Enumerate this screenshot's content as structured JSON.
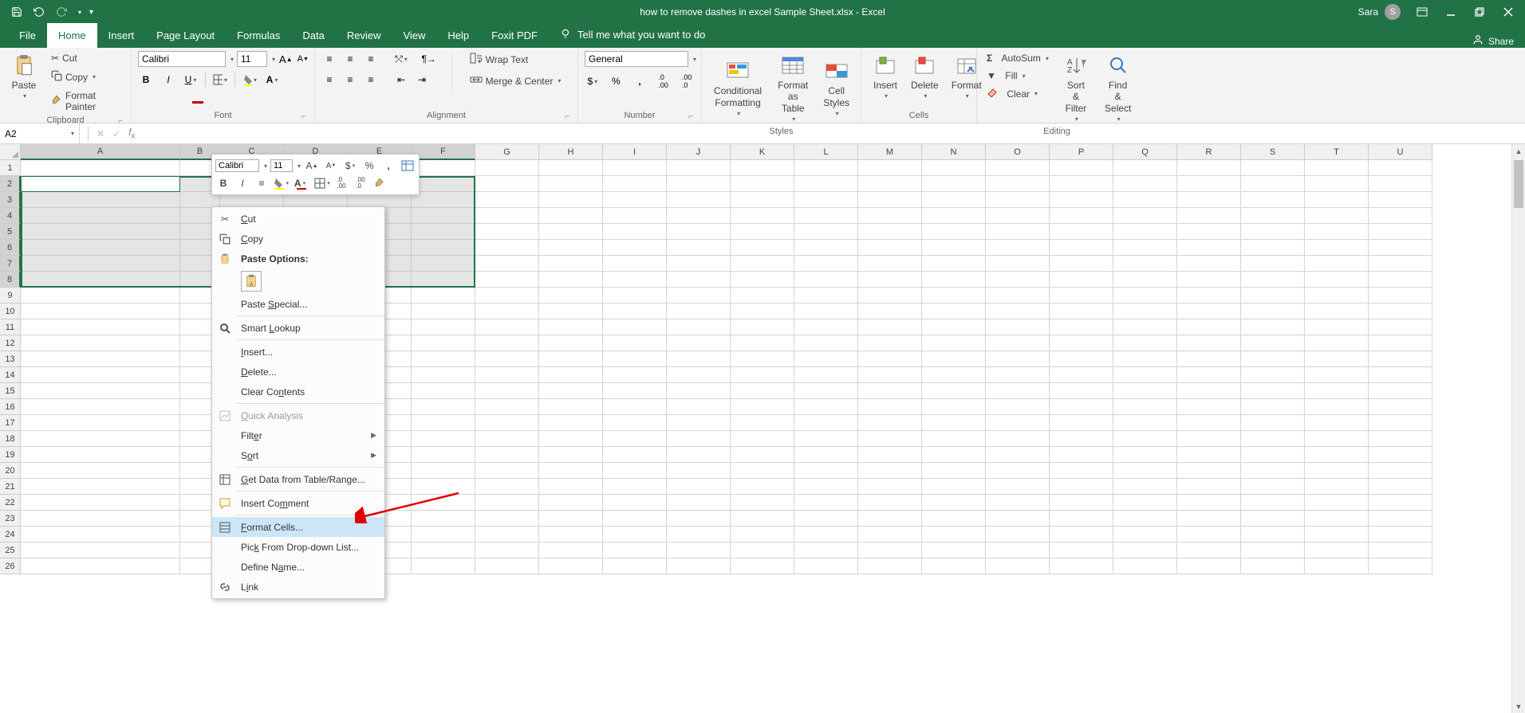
{
  "title": "how to remove dashes in excel Sample Sheet.xlsx  -  Excel",
  "user": {
    "name": "Sara",
    "initial": "S"
  },
  "share": "Share",
  "tabs": [
    "File",
    "Home",
    "Insert",
    "Page Layout",
    "Formulas",
    "Data",
    "Review",
    "View",
    "Help",
    "Foxit PDF"
  ],
  "active_tab": "Home",
  "tell_me": "Tell me what you want to do",
  "ribbon": {
    "clipboard": {
      "label": "Clipboard",
      "paste": "Paste",
      "cut": "Cut",
      "copy": "Copy",
      "fp": "Format Painter"
    },
    "font": {
      "label": "Font",
      "name": "Calibri",
      "size": "11"
    },
    "alignment": {
      "label": "Alignment",
      "wrap": "Wrap Text",
      "merge": "Merge & Center"
    },
    "number": {
      "label": "Number",
      "format": "General"
    },
    "styles": {
      "label": "Styles",
      "cond": "Conditional Formatting",
      "fas": "Format as Table",
      "cell": "Cell Styles"
    },
    "cells": {
      "label": "Cells",
      "insert": "Insert",
      "delete": "Delete",
      "format": "Format"
    },
    "editing": {
      "label": "Editing",
      "autosum": "AutoSum",
      "fill": "Fill",
      "clear": "Clear",
      "sort": "Sort & Filter",
      "find": "Find & Select"
    }
  },
  "namebox": "A2",
  "columns": [
    "A",
    "B",
    "C",
    "D",
    "E",
    "F",
    "G",
    "H",
    "I",
    "J",
    "K",
    "L",
    "M",
    "N",
    "O",
    "P",
    "Q",
    "R",
    "S",
    "T",
    "U"
  ],
  "col_widths": {
    "default": 80,
    "A": 200,
    "B": 50
  },
  "rows": 26,
  "selected_rows": [
    2,
    3,
    4,
    5,
    6,
    7,
    8
  ],
  "active_cell": "A2",
  "mini": {
    "font": "Calibri",
    "size": "11"
  },
  "context_menu": {
    "cut": "Cut",
    "copy": "Copy",
    "paste_options": "Paste Options:",
    "paste_special": "Paste Special...",
    "smart": "Smart Lookup",
    "insert": "Insert...",
    "delete": "Delete...",
    "clear": "Clear Contents",
    "quick": "Quick Analysis",
    "filter": "Filter",
    "sort": "Sort",
    "getdata": "Get Data from Table/Range...",
    "comment": "Insert Comment",
    "format": "Format Cells...",
    "pick": "Pick From Drop-down List...",
    "define": "Define Name...",
    "link": "Link"
  }
}
